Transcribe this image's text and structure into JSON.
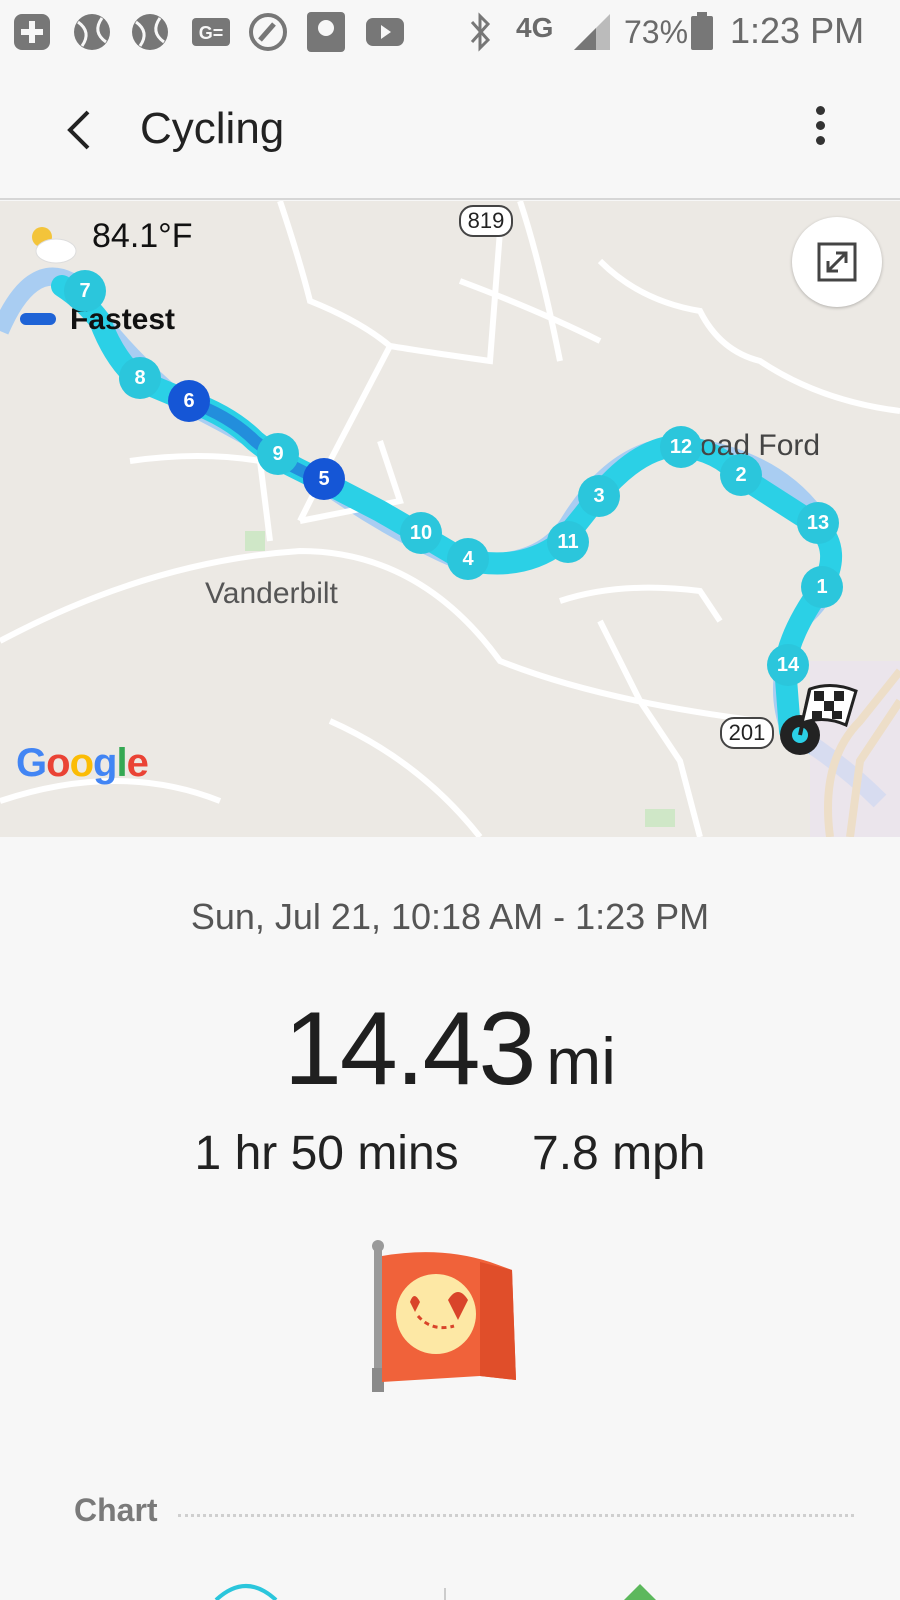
{
  "status_bar": {
    "battery_percent": "73%",
    "network": "4G",
    "time": "1:23 PM",
    "icons": [
      "add-icon",
      "sports-ball-icon",
      "sports-ball-icon",
      "ge-icon",
      "refresh-circle-icon",
      "sports-app-icon",
      "youtube-icon",
      "bluetooth-icon",
      "signal-icon",
      "battery-icon"
    ]
  },
  "app_bar": {
    "title": "Cycling",
    "back_icon": "chevron-left-icon",
    "more_icon": "more-vertical-icon"
  },
  "map": {
    "weather": {
      "temperature": "84.1°F",
      "icon": "partly-sunny-icon"
    },
    "legend_label": "Fastest",
    "expand_icon": "expand-icon",
    "labels": [
      "Vanderbilt",
      "oad Ford"
    ],
    "road_shields": [
      "819",
      "201"
    ],
    "attribution": "Google",
    "markers": [
      {
        "label": "7"
      },
      {
        "label": "8"
      },
      {
        "label": "6"
      },
      {
        "label": "9"
      },
      {
        "label": "5"
      },
      {
        "label": "10"
      },
      {
        "label": "4"
      },
      {
        "label": "11"
      },
      {
        "label": "3"
      },
      {
        "label": "12"
      },
      {
        "label": "2"
      },
      {
        "label": "13"
      },
      {
        "label": "1"
      },
      {
        "label": "14"
      }
    ],
    "finish_icon": "checkered-flag-icon",
    "colors": {
      "route": "#2bd0e6",
      "fastest": "#1e63d6",
      "marker": "#2bc6dc"
    }
  },
  "summary": {
    "date_range": "Sun, Jul 21, 10:18 AM - 1:23 PM",
    "distance_value": "14.43",
    "distance_unit": "mi",
    "duration": "1 hr 50 mins",
    "speed": "7.8 mph",
    "badge_icon": "route-flag-icon"
  },
  "chart_section": {
    "title": "Chart"
  }
}
